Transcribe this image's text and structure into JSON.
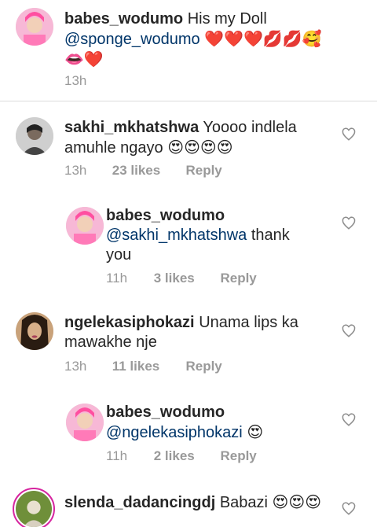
{
  "caption": {
    "username": "babes_wodumo",
    "text": "His my Doll",
    "mention": "@sponge_wodumo",
    "emojis_line1": "❤️❤️❤️💋💋🥰",
    "emojis_line2": "👄❤️",
    "time": "13h"
  },
  "comments": [
    {
      "username": "sakhi_mkhatshwa",
      "text_line1": "Yoooo indlela",
      "text_line2": "amuhle ngayo",
      "emojis": "😍😍😍😍",
      "time": "13h",
      "likes": "23 likes",
      "reply": "Reply"
    },
    {
      "username": "babes_wodumo",
      "mention": "@sakhi_mkhatshwa",
      "text_a": "thank",
      "text_b": "you",
      "time": "11h",
      "likes": "3 likes",
      "reply": "Reply"
    },
    {
      "username": "ngelekasiphokazi",
      "text_line1": "Unama lips ka",
      "text_line2": "mawakhe nje",
      "time": "13h",
      "likes": "11 likes",
      "reply": "Reply"
    },
    {
      "username": "babes_wodumo",
      "mention": "@ngelekasiphokazi",
      "emojis": "😍",
      "time": "11h",
      "likes": "2 likes",
      "reply": "Reply"
    },
    {
      "username": "slenda_dadancingdj",
      "text": "Babazi",
      "emojis": "😍😍😍"
    }
  ],
  "icons": {
    "like": "heart-outline-icon"
  },
  "colors": {
    "mention": "#003569",
    "meta": "#999999",
    "divider": "#dbdbdb",
    "story_ring": "#d6249f"
  }
}
